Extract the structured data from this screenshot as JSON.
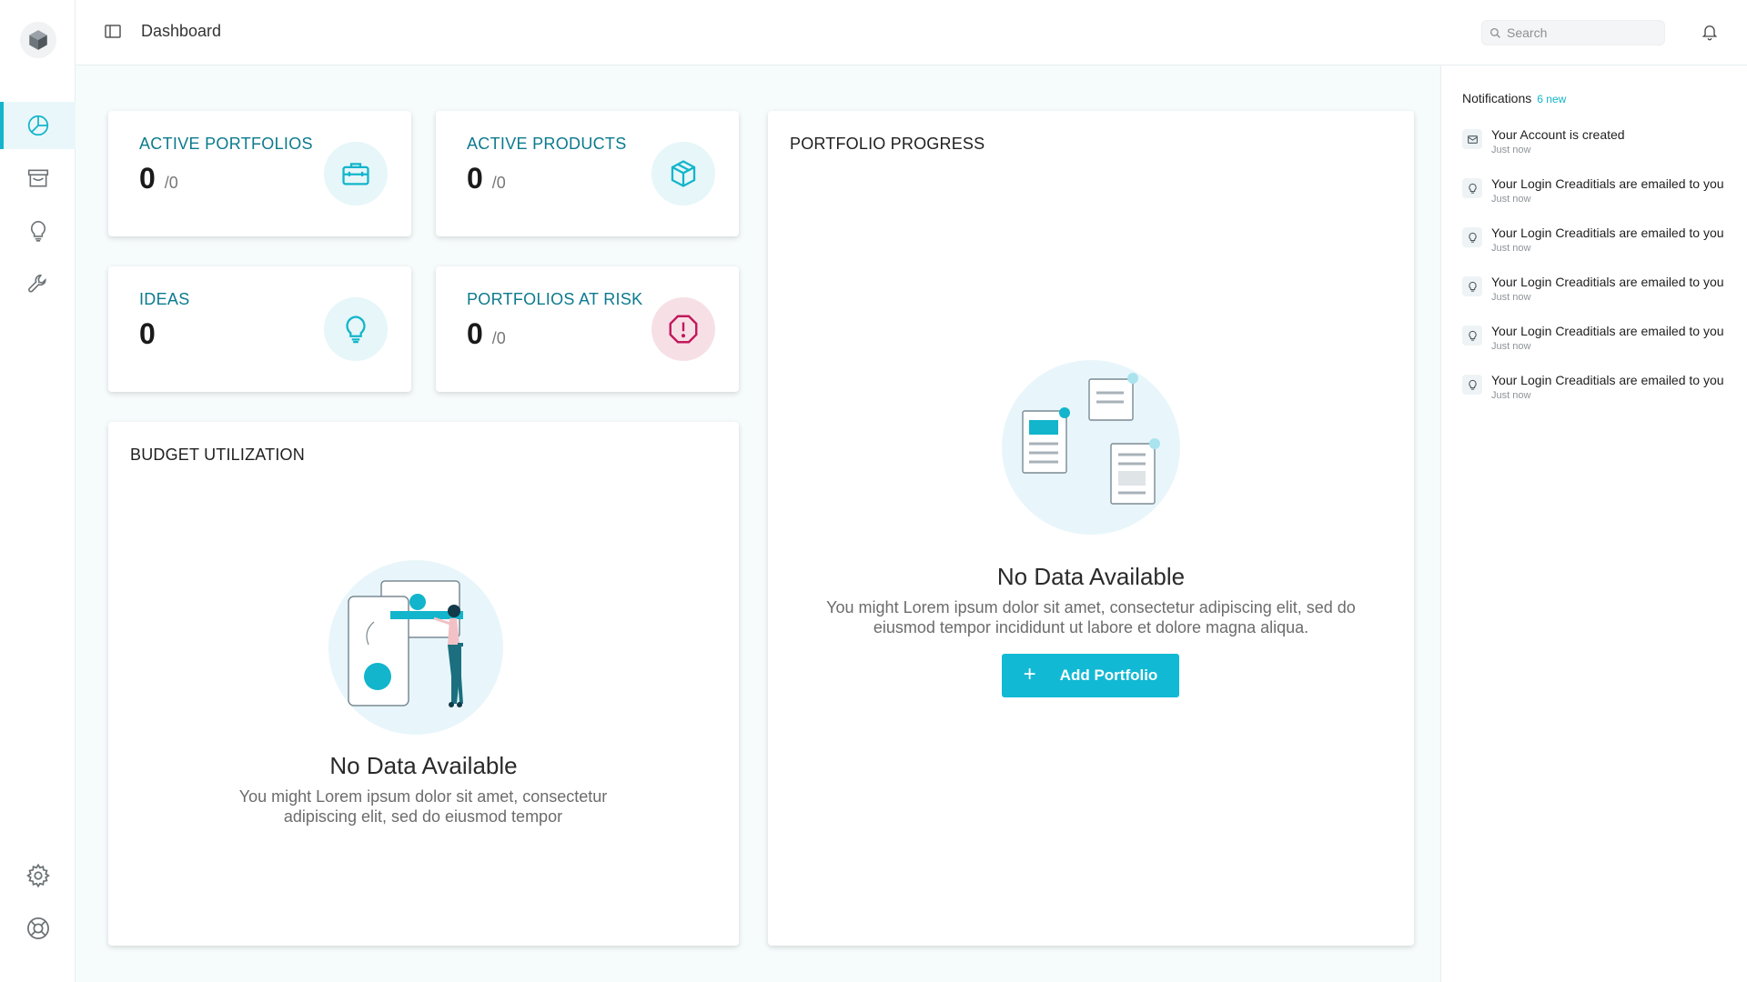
{
  "header": {
    "title": "Dashboard",
    "search_placeholder": "Search"
  },
  "sidebar": {
    "items": [
      {
        "name": "dashboard",
        "icon": "pie-chart-icon",
        "active": true
      },
      {
        "name": "archive",
        "icon": "archive-box-icon",
        "active": false
      },
      {
        "name": "ideas",
        "icon": "lightbulb-icon",
        "active": false
      },
      {
        "name": "tools",
        "icon": "wrench-icon",
        "active": false
      }
    ],
    "bottom_items": [
      {
        "name": "settings",
        "icon": "gear-icon"
      },
      {
        "name": "support",
        "icon": "lifebuoy-icon"
      }
    ]
  },
  "stats": [
    {
      "label": "ACTIVE PORTFOLIOS",
      "value": "0",
      "total": "/0",
      "icon": "briefcase-icon"
    },
    {
      "label": "ACTIVE PRODUCTS",
      "value": "0",
      "total": "/0",
      "icon": "cube-icon"
    },
    {
      "label": "IDEAS",
      "value": "0",
      "total": "",
      "icon": "lightbulb-icon"
    },
    {
      "label": "PORTFOLIOS AT RISK",
      "value": "0",
      "total": "/0",
      "icon": "alert-octagon-icon"
    }
  ],
  "budget": {
    "title": "BUDGET UTILIZATION",
    "empty_title": "No Data Available",
    "empty_desc": "You might Lorem ipsum dolor sit amet, consectetur adipiscing elit, sed do eiusmod tempor"
  },
  "portfolio_progress": {
    "title": "PORTFOLIO PROGRESS",
    "empty_title": "No Data Available",
    "empty_desc": "You might Lorem ipsum dolor sit amet, consectetur adipiscing elit, sed do eiusmod tempor incididunt ut labore et dolore magna aliqua.",
    "button_label": "Add Portfolio"
  },
  "notifications": {
    "title": "Notifications",
    "new_count": "6 new",
    "items": [
      {
        "text": "Your Account is created",
        "time": "Just now",
        "icon": "envelope-icon"
      },
      {
        "text": "Your Login Creaditials are emailed to you",
        "time": "Just now",
        "icon": "lightbulb-icon"
      },
      {
        "text": "Your Login Creaditials are emailed to you",
        "time": "Just now",
        "icon": "lightbulb-icon"
      },
      {
        "text": "Your Login Creaditials are emailed to you",
        "time": "Just now",
        "icon": "lightbulb-icon"
      },
      {
        "text": "Your Login Creaditials are emailed to you",
        "time": "Just now",
        "icon": "lightbulb-icon"
      },
      {
        "text": "Your Login Creaditials are emailed to you",
        "time": "Just now",
        "icon": "lightbulb-icon"
      }
    ]
  },
  "colors": {
    "accent": "#12b5cb",
    "accent_dark": "#0c7a8e",
    "risk": "#c2185b",
    "background": "#f6fbfc"
  }
}
